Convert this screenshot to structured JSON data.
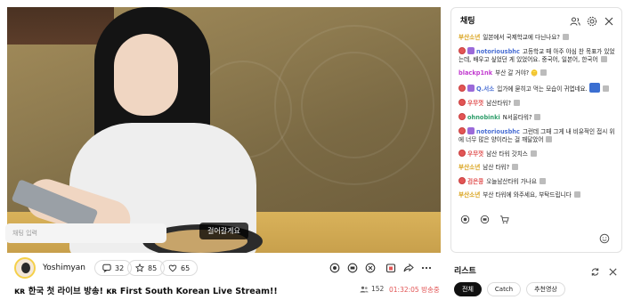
{
  "video": {
    "caption": "걸어갈게요"
  },
  "channel": {
    "name": "Yoshimyan"
  },
  "stats": {
    "chat_count": "32",
    "like_count": "85",
    "fav_count": "65"
  },
  "stream": {
    "title": "🇰🇷 한국 첫 라이브 방송! 🇰🇷 First South Korean Live Stream!!",
    "title_display": "ᴋʀ 한국 첫 라이브 방송! ᴋʀ First South Korean Live Stream!!",
    "viewers": "152",
    "live_time": "01:32:05 방송중"
  },
  "chat": {
    "title": "채팅",
    "input_placeholder": "채팅 입력",
    "messages": [
      {
        "name": "부산소년",
        "name_color": "#d9a21b",
        "badge": "none",
        "text": "일본에서 국제학교에 다닌나요?"
      },
      {
        "name": "notoriousbhc",
        "name_color": "#4a6fd4",
        "badge": "sub-mod",
        "text": "고등학교 때 아주 야심 찬 목표가 있었는데, 배우고 싶었던 게 있었어요. 중국어, 일본어, 한국어"
      },
      {
        "name": "blackp1nk",
        "name_color": "#c23bd0",
        "badge": "none",
        "text": "부산 갈 거야? 🪙"
      },
      {
        "name": "Q.서소",
        "name_color": "#4a6fd4",
        "badge": "sub-mod",
        "text": "입가에 묻히고 먹는 모습이 귀엽네요."
      },
      {
        "name": "우무껏",
        "name_color": "#e25555",
        "badge": "sub",
        "text": "남산타워?"
      },
      {
        "name": "ohnobinki",
        "name_color": "#2f9e6b",
        "badge": "sub",
        "text": "N서울타워?"
      },
      {
        "name": "notoriousbhc",
        "name_color": "#4a6fd4",
        "badge": "sub-mod",
        "text": "그런데 그때 그게 내 비유적인 접시 위에 너무 많은 양이라는 걸 깨달았어"
      },
      {
        "name": "우무껏",
        "name_color": "#e25555",
        "badge": "sub",
        "text": "남산 타워 갓치스"
      },
      {
        "name": "부산소년",
        "name_color": "#d9a21b",
        "badge": "none",
        "text": "남산 타워?"
      },
      {
        "name": "검은콩",
        "name_color": "#e25555",
        "badge": "sub",
        "text": "오늘남산타워 가나요"
      },
      {
        "name": "부산소년",
        "name_color": "#d9a21b",
        "badge": "none",
        "text": "부산 타워에 와주세요, 부탁드립니다"
      }
    ]
  },
  "list": {
    "title": "리스트",
    "chips": [
      "전체",
      "Catch",
      "추천영상"
    ]
  },
  "colors": {
    "accent_red": "#e25555",
    "avatar_ring": "#f5d04a"
  }
}
